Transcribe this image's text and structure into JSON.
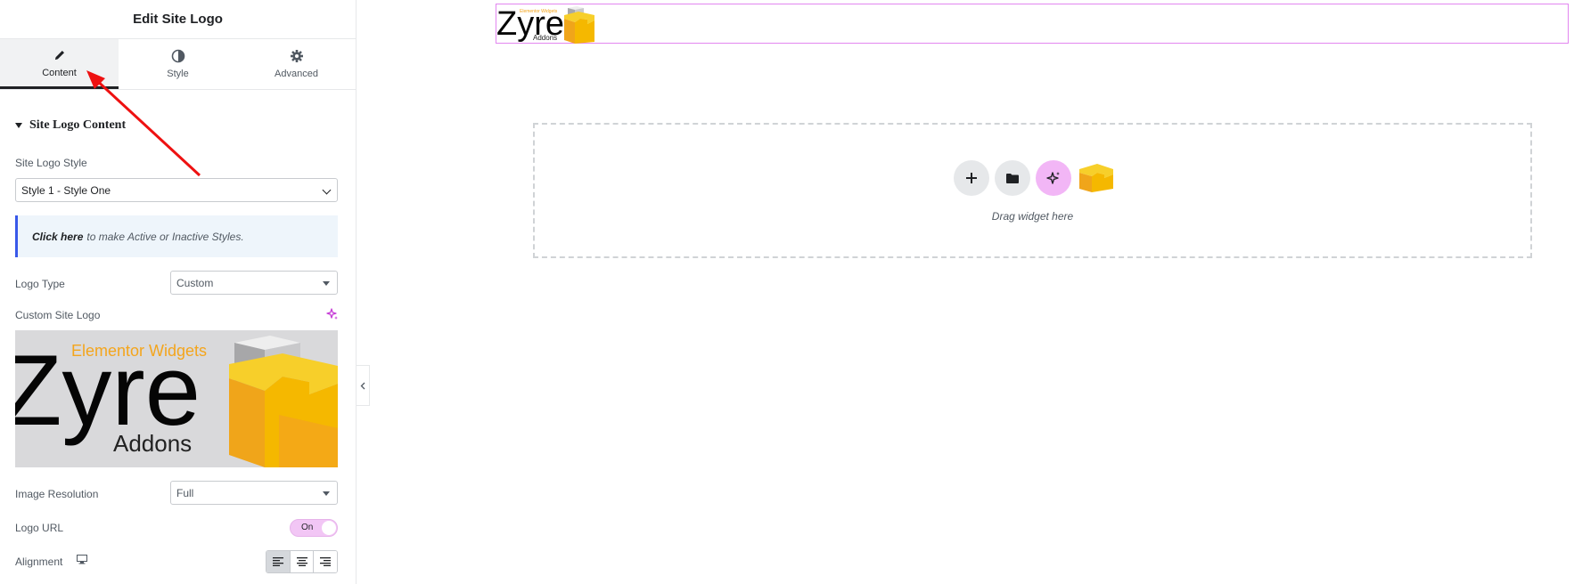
{
  "panel": {
    "title": "Edit Site Logo",
    "tabs": [
      {
        "label": "Content",
        "icon": "pencil-icon",
        "active": true
      },
      {
        "label": "Style",
        "icon": "contrast-icon",
        "active": false
      },
      {
        "label": "Advanced",
        "icon": "gear-icon",
        "active": false
      }
    ],
    "section_title": "Site Logo Content",
    "site_logo_style": {
      "label": "Site Logo Style",
      "value": "Style 1 - Style One"
    },
    "notice": {
      "link_text": "Click here",
      "text": "to make Active or Inactive Styles."
    },
    "logo_type": {
      "label": "Logo Type",
      "value": "Custom"
    },
    "custom_site_logo": {
      "label": "Custom Site Logo"
    },
    "logo_image": {
      "brand": "Zyre",
      "tagline": "Elementor Widgets",
      "sub": "Addons"
    },
    "image_resolution": {
      "label": "Image Resolution",
      "value": "Full"
    },
    "logo_url": {
      "label": "Logo URL",
      "toggle": "On"
    },
    "alignment": {
      "label": "Alignment",
      "device_icon": "desktop-icon",
      "options": [
        "align-left-icon",
        "align-center-icon",
        "align-right-icon"
      ],
      "selected": "align-left-icon"
    }
  },
  "canvas": {
    "header_logo": {
      "brand": "Zyre",
      "tagline": "Elementor Widgets",
      "sub": "Addons"
    },
    "drop_zone": {
      "text": "Drag widget here",
      "buttons": [
        "plus-icon",
        "folder-icon",
        "ai-sparkle-icon"
      ]
    }
  },
  "colors": {
    "accent": "#e286f0",
    "toggle_on": "#f2c6f5",
    "notice_border": "#3858e9",
    "annotation_arrow": "#ee1111",
    "logo_yellow": "#f5b800",
    "logo_orange": "#f4a51c"
  }
}
